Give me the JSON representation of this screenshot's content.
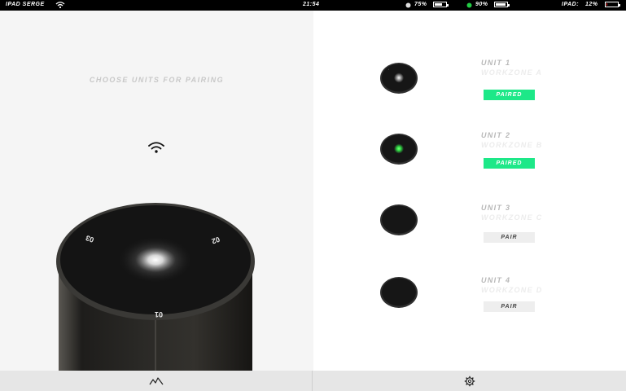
{
  "status_bar": {
    "carrier": "IPAD SERGE",
    "time": "21:54",
    "battery1": {
      "label": "75%",
      "level": 0.75
    },
    "battery2": {
      "label": "90%",
      "level": 0.9
    },
    "battery3": {
      "prefix": "IPAD:",
      "label": "12%",
      "level": 0.12,
      "color": "#ff2a2a"
    },
    "status_dot_color": "#22cc44"
  },
  "left": {
    "title": "CHOOSE UNITS FOR PAIRING",
    "wifi_icon": "wifi-icon",
    "device": {
      "dial_labels": [
        "03",
        "02",
        "01"
      ]
    }
  },
  "units": [
    {
      "name": "UNIT 1",
      "zone": "WORKZONE A",
      "status": "PAIRED",
      "paired": true,
      "light_color": "#ffffff"
    },
    {
      "name": "UNIT 2",
      "zone": "WORKZONE B",
      "status": "PAIRED",
      "paired": true,
      "light_color": "#35e84a"
    },
    {
      "name": "UNIT 3",
      "zone": "WORKZONE C",
      "status": "PAIR",
      "paired": false,
      "light_color": "none"
    },
    {
      "name": "UNIT 4",
      "zone": "WORKZONE D",
      "status": "PAIR",
      "paired": false,
      "light_color": "none"
    }
  ],
  "colors": {
    "paired": "#1de888",
    "accent_green": "#35e84a"
  },
  "tabs": [
    {
      "icon": "activity-graph-icon"
    },
    {
      "icon": "gear-icon"
    }
  ]
}
